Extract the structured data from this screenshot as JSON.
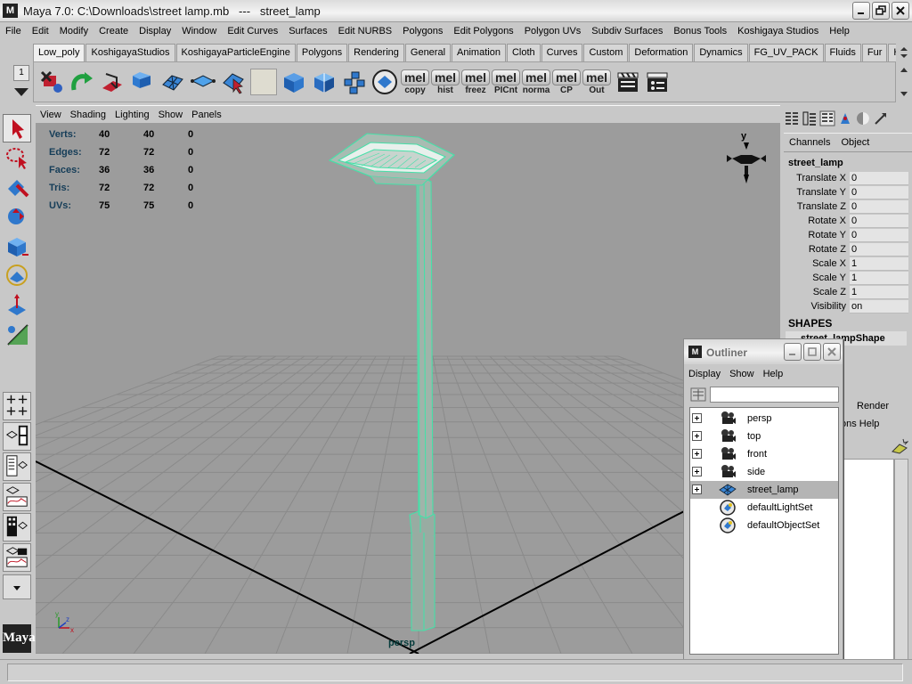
{
  "window": {
    "title": "Maya 7.0: C:\\Downloads\\street lamp.mb   ---   street_lamp",
    "app_icon": "M"
  },
  "menubar": [
    "File",
    "Edit",
    "Modify",
    "Create",
    "Display",
    "Window",
    "Edit Curves",
    "Surfaces",
    "Edit NURBS",
    "Polygons",
    "Edit Polygons",
    "Polygon UVs",
    "Subdiv Surfaces",
    "Bonus Tools",
    "Koshigaya Studios",
    "Help"
  ],
  "shelf": {
    "selector_value": "1",
    "tabs": [
      "Low_poly",
      "KoshigayaStudios",
      "KoshigayaParticleEngine",
      "Polygons",
      "Rendering",
      "General",
      "Animation",
      "Cloth",
      "Curves",
      "Custom",
      "Deformation",
      "Dynamics",
      "FG_UV_PACK",
      "Fluids",
      "Fur",
      "Hai"
    ],
    "active_tab": "Low_poly",
    "mel_buttons": [
      {
        "top": "mel",
        "bottom": "copy"
      },
      {
        "top": "mel",
        "bottom": "hist"
      },
      {
        "top": "mel",
        "bottom": "freez"
      },
      {
        "top": "mel",
        "bottom": "PICnt"
      },
      {
        "top": "mel",
        "bottom": "norma"
      },
      {
        "top": "mel",
        "bottom": "CP"
      },
      {
        "top": "mel",
        "bottom": "Out"
      }
    ]
  },
  "panel_menu": [
    "View",
    "Shading",
    "Lighting",
    "Show",
    "Panels"
  ],
  "hud": [
    {
      "label": "Verts:",
      "values": [
        "40",
        "40",
        "0"
      ]
    },
    {
      "label": "Edges:",
      "values": [
        "72",
        "72",
        "0"
      ]
    },
    {
      "label": "Faces:",
      "values": [
        "36",
        "36",
        "0"
      ]
    },
    {
      "label": "Tris:",
      "values": [
        "72",
        "72",
        "0"
      ]
    },
    {
      "label": "UVs:",
      "values": [
        "75",
        "75",
        "0"
      ]
    }
  ],
  "viewport": {
    "camera": "persp",
    "view_cube_axis": "y",
    "gizmo_axes": [
      "y",
      "z",
      "x"
    ],
    "colors": {
      "background": "#9c9c9c",
      "grid": "#8a8a8a",
      "axis": "#000000",
      "selection": "#46e0a8"
    }
  },
  "channel_box": {
    "menus": [
      "Channels",
      "Object"
    ],
    "object_name": "street_lamp",
    "attributes": [
      {
        "name": "Translate X",
        "value": "0"
      },
      {
        "name": "Translate Y",
        "value": "0"
      },
      {
        "name": "Translate Z",
        "value": "0"
      },
      {
        "name": "Rotate X",
        "value": "0"
      },
      {
        "name": "Rotate Y",
        "value": "0"
      },
      {
        "name": "Rotate Z",
        "value": "0"
      },
      {
        "name": "Scale X",
        "value": "1"
      },
      {
        "name": "Scale Y",
        "value": "1"
      },
      {
        "name": "Scale Z",
        "value": "1"
      },
      {
        "name": "Visibility",
        "value": "on"
      }
    ],
    "shapes_header": "SHAPES",
    "shape_name": "street_lampShape"
  },
  "render_strip": {
    "label": "Render",
    "help_row": "ons  Help"
  },
  "outliner": {
    "title": "Outliner",
    "menus": [
      "Display",
      "Show",
      "Help"
    ],
    "filter_value": "",
    "items": [
      {
        "label": "persp",
        "icon": "camera-icon",
        "expandable": true,
        "selected": false
      },
      {
        "label": "top",
        "icon": "camera-icon",
        "expandable": true,
        "selected": false
      },
      {
        "label": "front",
        "icon": "camera-icon",
        "expandable": true,
        "selected": false
      },
      {
        "label": "side",
        "icon": "camera-icon",
        "expandable": true,
        "selected": false
      },
      {
        "label": "street_lamp",
        "icon": "mesh-icon",
        "expandable": true,
        "selected": true
      },
      {
        "label": "defaultLightSet",
        "icon": "set-icon",
        "expandable": false,
        "selected": false
      },
      {
        "label": "defaultObjectSet",
        "icon": "set-icon",
        "expandable": false,
        "selected": false
      }
    ]
  }
}
